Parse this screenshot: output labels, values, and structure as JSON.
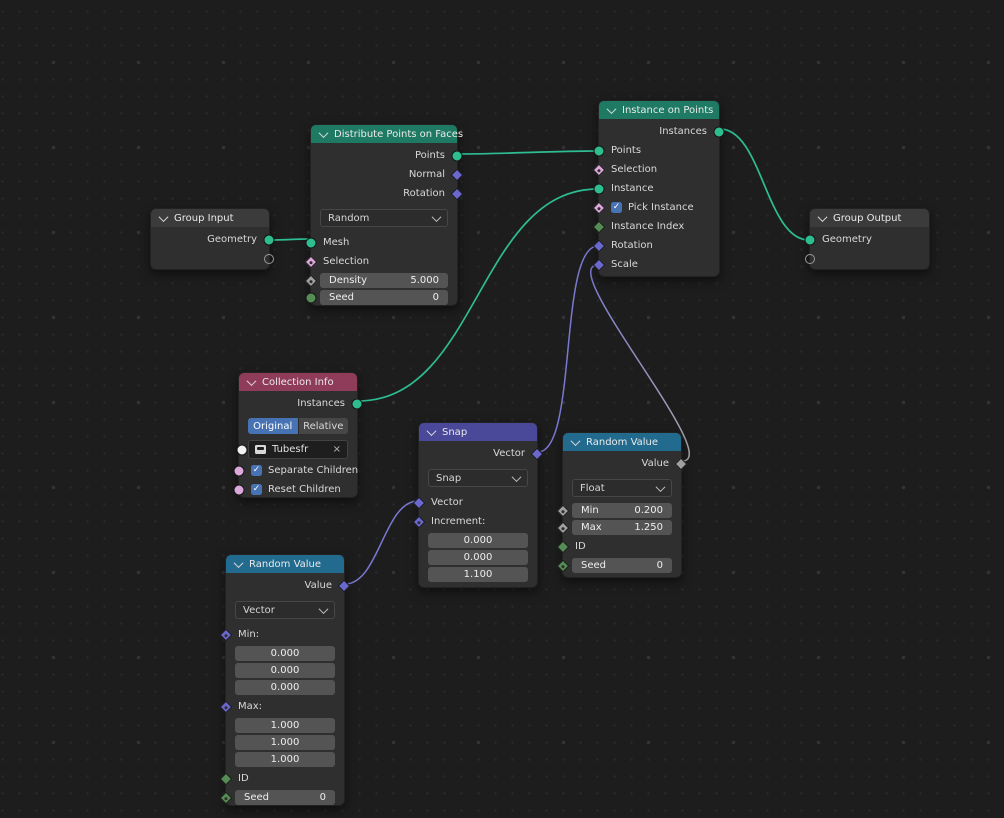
{
  "editor": "geometry-node-editor",
  "icons": {
    "check": "✓",
    "clear": "×"
  },
  "colors": {
    "canvas_bg": "#1d1d1d",
    "header_geometry": "#1f7a64",
    "header_group": "#3b3b3b",
    "header_input_collection": "#8e3c59",
    "header_vector": "#4a4899",
    "header_converter": "#226b8e",
    "wire_geometry": "#2ebd92",
    "wire_vector": "#7b78d2",
    "socket_geometry": "#2dbd8f",
    "socket_vector": "#6a68cd",
    "socket_boolean": "#dca8dc",
    "socket_float": "#a0a0a0",
    "socket_int": "#568c56",
    "socket_collection": "#f1f1f1",
    "checkbox_blue": "#4772b3"
  },
  "nodes": {
    "group_input": {
      "title": "Group Input",
      "output_geometry": "Geometry"
    },
    "distribute_points": {
      "title": "Distribute Points on Faces",
      "out_points": "Points",
      "out_normal": "Normal",
      "out_rotation": "Rotation",
      "distribution_dropdown": "Random",
      "in_mesh": "Mesh",
      "in_selection": "Selection",
      "density": {
        "label": "Density",
        "value": "5.000"
      },
      "seed": {
        "label": "Seed",
        "value": "0"
      }
    },
    "instance_on_points": {
      "title": "Instance on Points",
      "out_instances": "Instances",
      "in_points": "Points",
      "in_selection": "Selection",
      "in_instance": "Instance",
      "pick_instance": {
        "label": "Pick Instance",
        "checked": true
      },
      "in_instance_index": "Instance Index",
      "in_rotation": "Rotation",
      "in_scale": "Scale"
    },
    "group_output": {
      "title": "Group Output",
      "input_geometry": "Geometry"
    },
    "collection_info": {
      "title": "Collection Info",
      "out_instances": "Instances",
      "mode_original": "Original",
      "mode_relative": "Relative",
      "active_mode": "Original",
      "collection_name": "Tubesfr",
      "separate_children": {
        "label": "Separate Children",
        "checked": true
      },
      "reset_children": {
        "label": "Reset Children",
        "checked": true
      }
    },
    "snap": {
      "title": "Snap",
      "out_vector": "Vector",
      "operation_dropdown": "Snap",
      "in_vector": "Vector",
      "in_increment": "Increment:",
      "increment_values": [
        "0.000",
        "0.000",
        "1.100"
      ]
    },
    "random_value_float": {
      "title": "Random Value",
      "out_value": "Value",
      "type_dropdown": "Float",
      "min": {
        "label": "Min",
        "value": "0.200"
      },
      "max": {
        "label": "Max",
        "value": "1.250"
      },
      "id_label": "ID",
      "seed": {
        "label": "Seed",
        "value": "0"
      }
    },
    "random_value_vector": {
      "title": "Random Value",
      "out_value": "Value",
      "type_dropdown": "Vector",
      "min_label": "Min:",
      "min_values": [
        "0.000",
        "0.000",
        "0.000"
      ],
      "max_label": "Max:",
      "max_values": [
        "1.000",
        "1.000",
        "1.000"
      ],
      "id_label": "ID",
      "seed": {
        "label": "Seed",
        "value": "0"
      }
    }
  },
  "links": [
    {
      "from": "group_input.Geometry",
      "to": "distribute_points.Mesh",
      "type": "geometry"
    },
    {
      "from": "distribute_points.Points",
      "to": "instance_on_points.Points",
      "type": "geometry"
    },
    {
      "from": "collection_info.Instances",
      "to": "instance_on_points.Instance",
      "type": "geometry"
    },
    {
      "from": "instance_on_points.Instances",
      "to": "group_output.Geometry",
      "type": "geometry"
    },
    {
      "from": "snap.Vector",
      "to": "instance_on_points.Rotation",
      "type": "vector"
    },
    {
      "from": "random_value_float.Value",
      "to": "instance_on_points.Scale",
      "type": "float-vector"
    },
    {
      "from": "random_value_vector.Value",
      "to": "snap.Vector",
      "type": "vector"
    }
  ]
}
